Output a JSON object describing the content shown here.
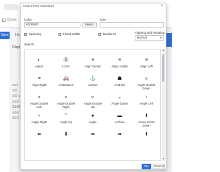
{
  "background": {
    "close_label": "Close",
    "save_label": "Save",
    "tab_label": "Hone",
    "heading": "Display",
    "text_lines": [
      "ou'r",
      "SO",
      "SO is utilize",
      "your best o",
      "$108.90 do",
      "your have",
      "SLO is a tur"
    ]
  },
  "modal": {
    "title": "Insert Font Awesome",
    "close_icon": "×",
    "color_label": "Color",
    "color_value": "#000000",
    "select_label": "Select",
    "size_label": "Size",
    "size_value": "",
    "spinning_label": "Spinning",
    "fixed_width_label": "Fixed Width",
    "bordered_label": "Bordered",
    "flip_rotate_label": "Flipping and Rotating",
    "flip_rotate_value": "Normal",
    "search_label": "Search",
    "ok_label": "OK",
    "cancel_label": "Cancel"
  },
  "icons": [
    {
      "name": "Adjust",
      "icon": "adjust-icon",
      "glyph": "◐"
    },
    {
      "name": "A.D.N.",
      "icon": "adn-icon",
      "glyph": "Ⓐ"
    },
    {
      "name": "Align Center",
      "icon": "align-center-icon",
      "glyph": "≡"
    },
    {
      "name": "Align Justify",
      "icon": "align-justify-icon",
      "glyph": "≡"
    },
    {
      "name": "Align Left",
      "icon": "align-left-icon",
      "glyph": "≡"
    },
    {
      "name": "Align Right",
      "icon": "align-right-icon",
      "glyph": "≡"
    },
    {
      "name": "Ambulance",
      "icon": "ambulance-icon",
      "glyph": "🚑"
    },
    {
      "name": "Anchor",
      "icon": "anchor-icon",
      "glyph": "⚓"
    },
    {
      "name": "Android",
      "icon": "android-icon",
      "glyph": "☗"
    },
    {
      "name": "Angle Double Down",
      "icon": "angle-double-down-icon",
      "glyph": "»"
    },
    {
      "name": "Angle Double Left",
      "icon": "angle-double-left-icon",
      "glyph": "«"
    },
    {
      "name": "Angle Double Right",
      "icon": "angle-double-right-icon",
      "glyph": "»"
    },
    {
      "name": "Angle Double Up",
      "icon": "angle-double-up-icon",
      "glyph": "«"
    },
    {
      "name": "Angle Down",
      "icon": "angle-down-icon",
      "glyph": "⌄"
    },
    {
      "name": "Angle Left",
      "icon": "angle-left-icon",
      "glyph": "‹"
    },
    {
      "name": "Angle Right",
      "icon": "angle-right-icon",
      "glyph": "›"
    },
    {
      "name": "Angle Up",
      "icon": "angle-up-icon",
      "glyph": "⌃"
    },
    {
      "name": "Apple",
      "icon": "apple-icon",
      "glyph": "●"
    },
    {
      "name": "Archive",
      "icon": "archive-icon",
      "glyph": "▬"
    },
    {
      "name": "Arrow Circle Down",
      "icon": "arrow-circle-down-icon",
      "glyph": "⬇"
    },
    {
      "name": "",
      "icon": "arrow-circle-left-icon",
      "glyph": "⬅"
    },
    {
      "name": "",
      "icon": "arrow-circle-o-down-icon",
      "glyph": "⬇"
    },
    {
      "name": "",
      "icon": "arrow-circle-o-left-icon",
      "glyph": "⬅"
    },
    {
      "name": "",
      "icon": "arrow-circle-o-right-icon",
      "glyph": "➡"
    },
    {
      "name": "",
      "icon": "arrow-circle-o-up-icon",
      "glyph": "⬆"
    }
  ],
  "colors": {
    "accent": "#2f6fd1",
    "border": "#c9ccd1"
  }
}
